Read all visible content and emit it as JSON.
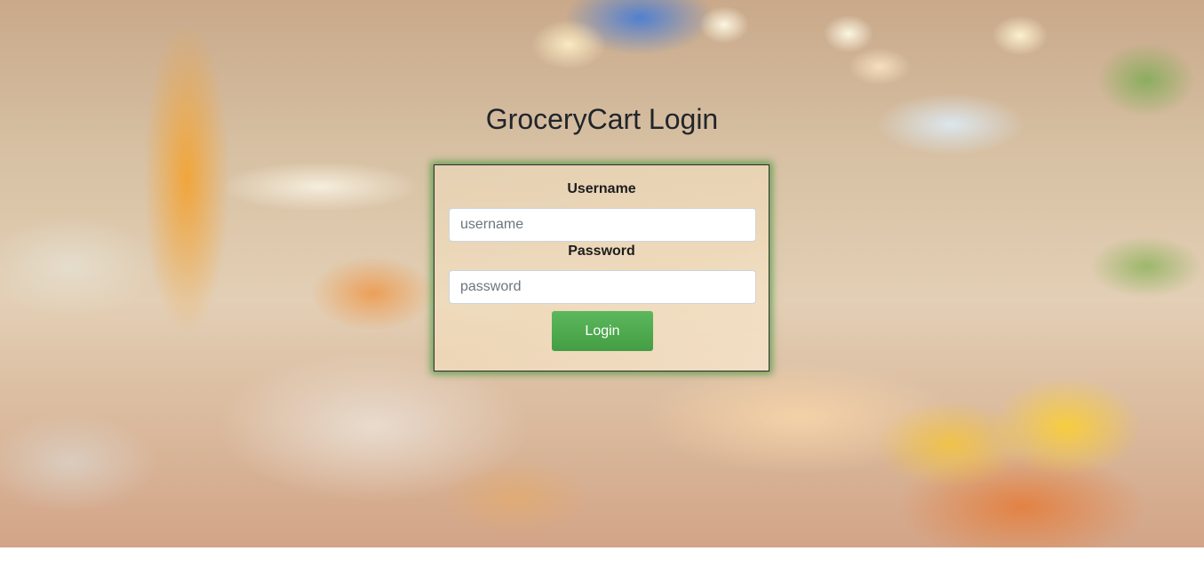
{
  "page": {
    "title": "GroceryCart Login"
  },
  "login_form": {
    "username_label": "Username",
    "username_placeholder": "username",
    "username_value": "",
    "password_label": "Password",
    "password_placeholder": "password",
    "password_value": "",
    "login_button_label": "Login"
  },
  "colors": {
    "accent_green": "#5cb85c",
    "card_glow": "#2e8b2e",
    "title_text": "#21252b"
  }
}
